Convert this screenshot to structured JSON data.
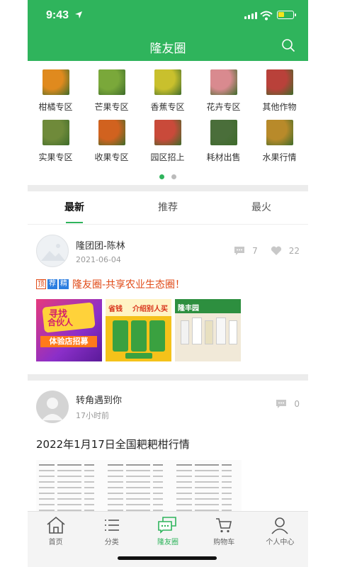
{
  "status": {
    "time": "9:43"
  },
  "header": {
    "title": "隆友圈"
  },
  "categories": [
    {
      "label": "柑橘专区",
      "color": "#e08a1e"
    },
    {
      "label": "芒果专区",
      "color": "#7aa83a"
    },
    {
      "label": "香蕉专区",
      "color": "#c9c02d"
    },
    {
      "label": "花卉专区",
      "color": "#d98a8f"
    },
    {
      "label": "其他作物",
      "color": "#b9413a"
    },
    {
      "label": "实果专区",
      "color": "#6f8a3a"
    },
    {
      "label": "收果专区",
      "color": "#d1621f"
    },
    {
      "label": "园区招上",
      "color": "#c94a3a"
    },
    {
      "label": "耗材出售",
      "color": "#4a6e3a"
    },
    {
      "label": "水果行情",
      "color": "#b88a2a"
    }
  ],
  "carousel": {
    "page_count": 2,
    "active_index": 0
  },
  "tabs": [
    "最新",
    "推荐",
    "最火"
  ],
  "posts": [
    {
      "user": "隆团团-陈林",
      "date": "2021-06-04",
      "comments": "7",
      "likes": "22",
      "badges": {
        "top": "顶",
        "rec": "荐",
        "fine": "精"
      },
      "title": "隆友圈-共享农业生态圈！",
      "images": [
        {
          "caption_a": "寻找",
          "caption_b": "合伙人",
          "caption_c": "体验店招募"
        },
        {
          "caption_a": "省钱",
          "caption_b": "介绍别人买"
        },
        {
          "caption_a": "隆丰园"
        }
      ]
    },
    {
      "user": "转角遇到你",
      "date": "17小时前",
      "comments": "0",
      "title": "2022年1月17日全国耙耙柑行情"
    }
  ],
  "bottom_nav": [
    {
      "label": "首页",
      "icon": "home-icon"
    },
    {
      "label": "分类",
      "icon": "list-icon"
    },
    {
      "label": "隆友圈",
      "icon": "chat-bubbles-icon"
    },
    {
      "label": "购物车",
      "icon": "cart-icon"
    },
    {
      "label": "个人中心",
      "icon": "person-icon"
    }
  ],
  "colors": {
    "brand": "#2fb45c",
    "accent": "#e04a17",
    "badge_blue": "#2b7de0"
  }
}
